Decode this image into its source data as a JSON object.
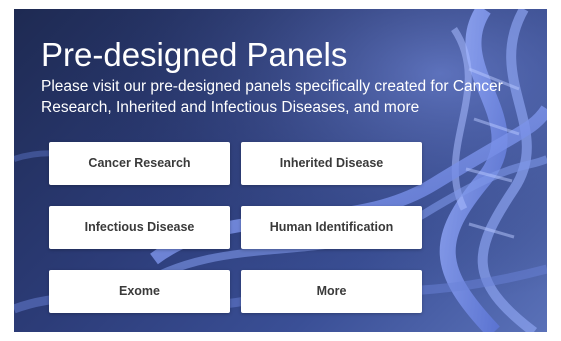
{
  "hero": {
    "title": "Pre-designed Panels",
    "description": "Please visit our pre-designed panels specifically created for Cancer Research, Inherited and Infectious Diseases, and more",
    "background_image": "blue-dna-helix"
  },
  "panels": [
    {
      "label": "Cancer Research"
    },
    {
      "label": "Inherited Disease"
    },
    {
      "label": "Infectious Disease"
    },
    {
      "label": "Human Identification"
    },
    {
      "label": "Exome"
    },
    {
      "label": "More"
    }
  ],
  "colors": {
    "background": "#2c3c78",
    "button_background": "#ffffff",
    "button_text": "#3a3a3a",
    "title_text": "#ffffff"
  }
}
